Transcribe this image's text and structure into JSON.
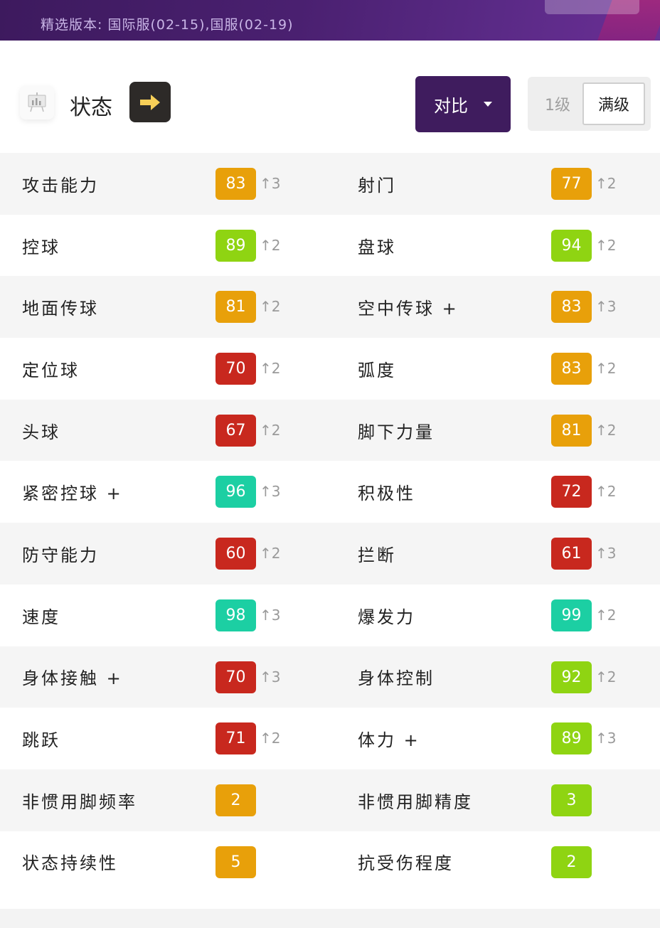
{
  "banner": {
    "cut_text_left": "",
    "cut_text_teal": "",
    "version_text": "精选版本: 国际服(02-15),国服(02-19)"
  },
  "header": {
    "title": "状态",
    "compare_label": "对比",
    "level_1": "1级",
    "level_max": "满级"
  },
  "colors": {
    "orange": "#e8a00a",
    "lime": "#8fd412",
    "red": "#c8281e",
    "teal": "#1ccfa3",
    "purple": "#3f1c5e"
  },
  "stats": [
    {
      "left": {
        "label": "攻击能力",
        "value": "83",
        "inc": "↑3",
        "color": "orange"
      },
      "right": {
        "label": "射门",
        "value": "77",
        "inc": "↑2",
        "color": "orange"
      }
    },
    {
      "left": {
        "label": "控球",
        "value": "89",
        "inc": "↑2",
        "color": "lime"
      },
      "right": {
        "label": "盘球",
        "value": "94",
        "inc": "↑2",
        "color": "lime"
      }
    },
    {
      "left": {
        "label": "地面传球",
        "value": "81",
        "inc": "↑2",
        "color": "orange"
      },
      "right": {
        "label": "空中传球 +",
        "value": "83",
        "inc": "↑3",
        "color": "orange"
      }
    },
    {
      "left": {
        "label": "定位球",
        "value": "70",
        "inc": "↑2",
        "color": "red"
      },
      "right": {
        "label": "弧度",
        "value": "83",
        "inc": "↑2",
        "color": "orange"
      }
    },
    {
      "left": {
        "label": "头球",
        "value": "67",
        "inc": "↑2",
        "color": "red"
      },
      "right": {
        "label": "脚下力量",
        "value": "81",
        "inc": "↑2",
        "color": "orange"
      }
    },
    {
      "left": {
        "label": "紧密控球 +",
        "value": "96",
        "inc": "↑3",
        "color": "teal"
      },
      "right": {
        "label": "积极性",
        "value": "72",
        "inc": "↑2",
        "color": "red"
      }
    },
    {
      "left": {
        "label": "防守能力",
        "value": "60",
        "inc": "↑2",
        "color": "red"
      },
      "right": {
        "label": "拦断",
        "value": "61",
        "inc": "↑3",
        "color": "red"
      }
    },
    {
      "left": {
        "label": "速度",
        "value": "98",
        "inc": "↑3",
        "color": "teal"
      },
      "right": {
        "label": "爆发力",
        "value": "99",
        "inc": "↑2",
        "color": "teal"
      }
    },
    {
      "left": {
        "label": "身体接触 +",
        "value": "70",
        "inc": "↑3",
        "color": "red"
      },
      "right": {
        "label": "身体控制",
        "value": "92",
        "inc": "↑2",
        "color": "lime"
      }
    },
    {
      "left": {
        "label": "跳跃",
        "value": "71",
        "inc": "↑2",
        "color": "red"
      },
      "right": {
        "label": "体力 +",
        "value": "89",
        "inc": "↑3",
        "color": "lime"
      }
    },
    {
      "left": {
        "label": "非惯用脚频率",
        "value": "2",
        "inc": "",
        "color": "orange"
      },
      "right": {
        "label": "非惯用脚精度",
        "value": "3",
        "inc": "",
        "color": "lime"
      }
    },
    {
      "left": {
        "label": "状态持续性",
        "value": "5",
        "inc": "",
        "color": "orange"
      },
      "right": {
        "label": "抗受伤程度",
        "value": "2",
        "inc": "",
        "color": "lime"
      }
    }
  ]
}
